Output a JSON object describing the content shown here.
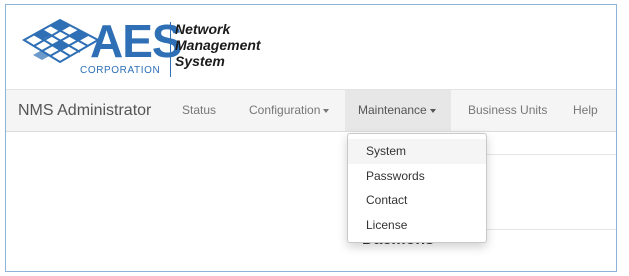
{
  "logo": {
    "wordmark": "AES",
    "corporation": "CORPORATION",
    "tagline": [
      "Network",
      "Management",
      "System"
    ],
    "brand_color": "#2e6fb5",
    "icon": "aes-globe-logo-icon"
  },
  "navbar": {
    "brand": "NMS Administrator",
    "items": [
      {
        "label": "Status",
        "has_caret": false,
        "active": false
      },
      {
        "label": "Configuration",
        "has_caret": true,
        "active": false
      },
      {
        "label": "Maintenance",
        "has_caret": true,
        "active": true
      },
      {
        "label": "Business Units",
        "has_caret": false,
        "active": false
      },
      {
        "label": "Help",
        "has_caret": false,
        "active": false
      }
    ]
  },
  "dropdown": {
    "parent": "Maintenance",
    "items": [
      {
        "label": "System",
        "highlighted": true
      },
      {
        "label": "Passwords",
        "highlighted": false
      },
      {
        "label": "Contact",
        "highlighted": false
      },
      {
        "label": "License",
        "highlighted": false
      }
    ]
  },
  "content": {
    "section_heading": "Daemons"
  },
  "colors": {
    "navbar_bg": "#f5f5f5",
    "active_tab_bg": "#e7e7e7",
    "frame_border": "#8fb2d9"
  }
}
